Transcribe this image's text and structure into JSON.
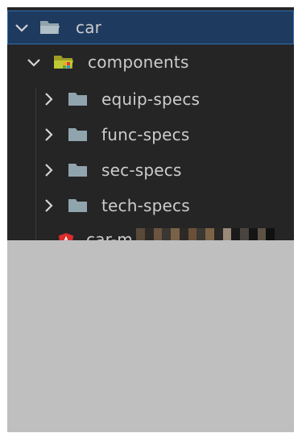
{
  "tree": {
    "root": {
      "label": "car",
      "expanded": true,
      "icon": "open-folder-icon"
    },
    "components": {
      "label": "components",
      "expanded": true,
      "icon": "components-folder-icon"
    },
    "children": [
      {
        "label": "equip-specs",
        "expanded": false,
        "icon": "folder-icon"
      },
      {
        "label": "func-specs",
        "expanded": false,
        "icon": "folder-icon"
      },
      {
        "label": "sec-specs",
        "expanded": false,
        "icon": "folder-icon"
      },
      {
        "label": "tech-specs",
        "expanded": false,
        "icon": "folder-icon"
      }
    ],
    "file": {
      "label": "car-m",
      "icon": "angular-icon"
    }
  },
  "colors": {
    "sidebar_bg": "#252526",
    "selected_bg": "#1e3a5f",
    "selected_border": "#2f6fb2",
    "text": "#cccccc",
    "folder": "#90a4ae",
    "components_folder": "#c0ca33",
    "angular": "#dd2c2c"
  }
}
